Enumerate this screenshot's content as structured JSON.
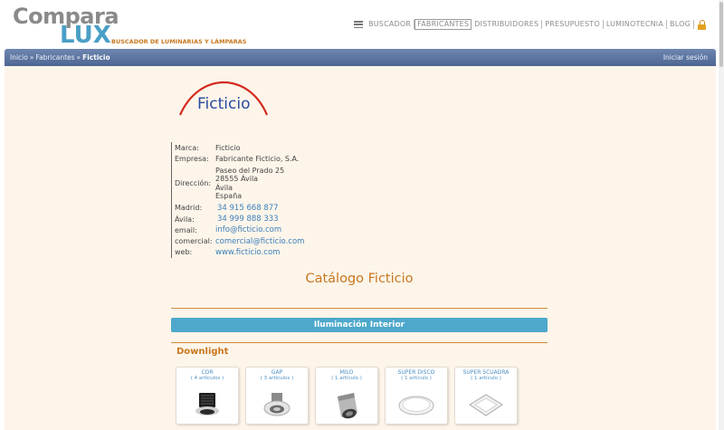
{
  "header": {
    "logo_top": "Compara",
    "logo_bottom": "LUX",
    "tagline": "BUSCADOR DE LUMINARIAS Y LÁMPARAS",
    "nav": [
      {
        "label": "BUSCADOR",
        "active": false
      },
      {
        "label": "FABRICANTES",
        "active": true
      },
      {
        "label": "DISTRIBUIDORES",
        "active": false
      },
      {
        "label": "PRESUPUESTO",
        "active": false
      },
      {
        "label": "LUMINOTECNIA",
        "active": false
      },
      {
        "label": "BLOG",
        "active": false
      }
    ]
  },
  "breadcrumb": {
    "items": [
      "Inicio",
      "Fabricantes",
      "Ficticio"
    ],
    "separator": "»",
    "login": "Iniciar sesión"
  },
  "brand": {
    "logo_text": "Ficticio",
    "logo_arc_color": "#d42a1e",
    "logo_text_color": "#2a4aa0"
  },
  "info": {
    "marca_label": "Marca:",
    "marca": "Ficticio",
    "empresa_label": "Empresa:",
    "empresa": "Fabricante Ficticio, S.A.",
    "direccion_label": "Dirección:",
    "direccion": [
      "Paseo del Prado 25",
      "28555 Ávila",
      "Ávila",
      "España"
    ],
    "madrid_label": "Madrid:",
    "madrid": "34 915 668 877",
    "avila_label": "Ávila:",
    "avila": "34 999 888 333",
    "email_label": "email:",
    "email": "info@ficticio.com",
    "comercial_label": "comercial:",
    "comercial": "comercial@ficticio.com",
    "web_label": "web:",
    "web": "www.ficticio.com"
  },
  "catalog": {
    "title": "Catálogo Ficticio",
    "section": "Iluminación Interior",
    "subcategory": "Downlight",
    "products": [
      {
        "name": "COR",
        "count": "( 4 artículos )"
      },
      {
        "name": "GAP",
        "count": "( 3 artículos )"
      },
      {
        "name": "MILO",
        "count": "( 1 artículo )"
      },
      {
        "name": "SUPER DISCO",
        "count": "( 1 artículo )"
      },
      {
        "name": "SUPER SCUADRA",
        "count": "( 1 artículo )"
      }
    ]
  },
  "colors": {
    "accent_orange": "#c8781f",
    "link_blue": "#3a7fbc",
    "bar_blue": "#4ea8cb",
    "content_bg": "#fdf5ea"
  }
}
